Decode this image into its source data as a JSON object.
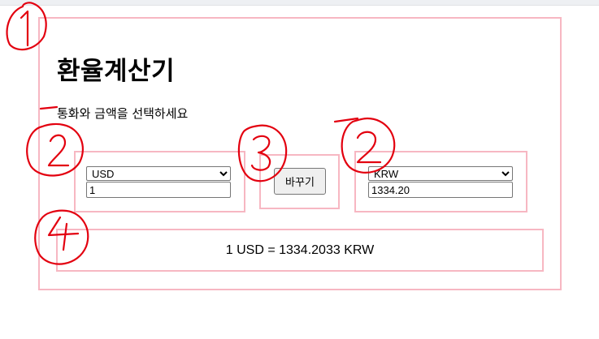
{
  "app": {
    "title": "환율계산기",
    "subtitle": "통화와 금액을 선택하세요"
  },
  "from": {
    "currency": "USD",
    "options": [
      "USD"
    ],
    "amount": "1"
  },
  "swap": {
    "label": "바꾸기"
  },
  "to": {
    "currency": "KRW",
    "options": [
      "KRW"
    ],
    "amount": "1334.20"
  },
  "result": {
    "text": "1 USD = 1334.2033 KRW"
  },
  "annotations": {
    "color": "#e3000f",
    "box_color": "#f7b7c2"
  }
}
